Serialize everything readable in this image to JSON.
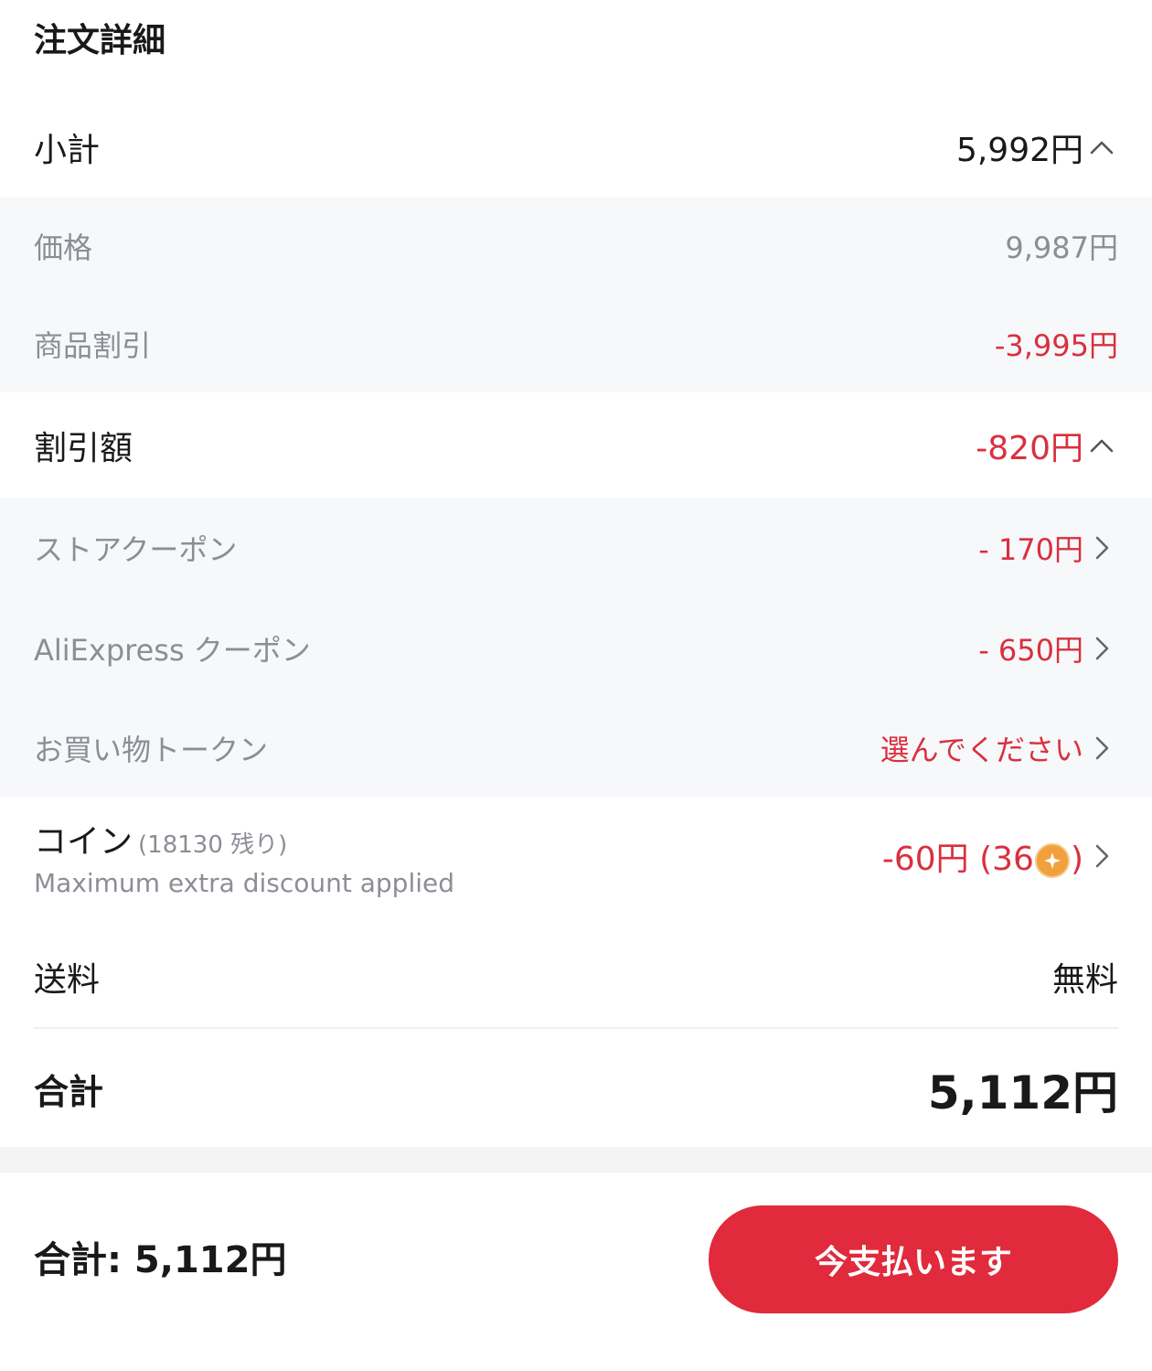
{
  "order": {
    "title": "注文詳細",
    "subtotal": {
      "label": "小計",
      "value": "5,992円"
    },
    "price": {
      "label": "価格",
      "value": "9,987円"
    },
    "product_discount": {
      "label": "商品割引",
      "value": "-3,995円"
    },
    "discount": {
      "label": "割引額",
      "value": "-820円"
    },
    "store_coupon": {
      "label": "ストアクーポン",
      "value": "- 170円"
    },
    "aliexpress_coupon": {
      "label": "AliExpress クーポン",
      "value": "- 650円"
    },
    "shopping_token": {
      "label": "お買い物トークン",
      "value": "選んでください"
    },
    "coins": {
      "label": "コイン",
      "remaining": "(18130 残り)",
      "note": "Maximum extra discount applied",
      "value_prefix": "-60円 (36",
      "value_suffix": ")"
    },
    "shipping": {
      "label": "送料",
      "value": "無料"
    },
    "total": {
      "label": "合計",
      "value": "5,112円"
    }
  },
  "bottom_bar": {
    "total_text": "合計: 5,112円",
    "pay_button_label": "今支払います"
  },
  "colors": {
    "accent_red": "#e12a3c",
    "discount_red": "#d9303f",
    "coin_orange": "#f2a03c",
    "muted_text": "#8c8e96",
    "sub_row_bg": "#f7f8fa"
  },
  "icons": {
    "collapse": "chevron-up-icon",
    "navigate": "chevron-right-icon",
    "coin": "coin-icon"
  }
}
